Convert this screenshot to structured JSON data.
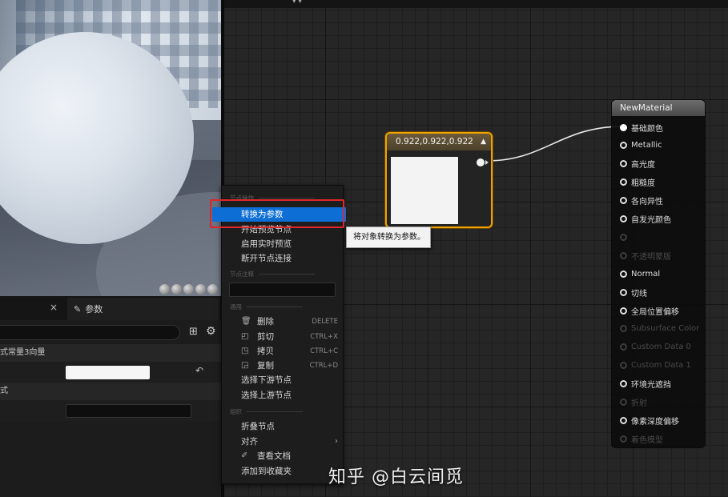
{
  "preview": {
    "view_mode_icons": [
      "sphere-icon",
      "sphere-icon",
      "cylinder-icon",
      "plane-icon",
      "teapot-icon"
    ]
  },
  "details": {
    "close_glyph": "×",
    "params_tab_label": "参数",
    "category1": "式常量3向量",
    "category2": "式",
    "reset_glyph": "↶"
  },
  "constant_node": {
    "title": "0.922,0.922,0.922",
    "color": "#ebebeb"
  },
  "material_node": {
    "title": "NewMaterial",
    "pins": [
      {
        "label": "基础颜色",
        "connected": true,
        "enabled": true
      },
      {
        "label": "Metallic",
        "connected": false,
        "enabled": true
      },
      {
        "label": "高光度",
        "connected": false,
        "enabled": true
      },
      {
        "label": "粗糙度",
        "connected": false,
        "enabled": true
      },
      {
        "label": "各向异性",
        "connected": false,
        "enabled": true
      },
      {
        "label": "自发光颜色",
        "connected": false,
        "enabled": true
      },
      {
        "label": "",
        "connected": false,
        "enabled": false
      },
      {
        "label": "不透明蒙版",
        "connected": false,
        "enabled": false
      },
      {
        "label": "Normal",
        "connected": false,
        "enabled": true
      },
      {
        "label": "切线",
        "connected": false,
        "enabled": true
      },
      {
        "label": "全局位置偏移",
        "connected": false,
        "enabled": true
      },
      {
        "label": "Subsurface Color",
        "connected": false,
        "enabled": false
      },
      {
        "label": "Custom Data 0",
        "connected": false,
        "enabled": false
      },
      {
        "label": "Custom Data 1",
        "connected": false,
        "enabled": false
      },
      {
        "label": "环境光遮挡",
        "connected": false,
        "enabled": true
      },
      {
        "label": "折射",
        "connected": false,
        "enabled": false
      },
      {
        "label": "像素深度偏移",
        "connected": false,
        "enabled": true
      },
      {
        "label": "着色模型",
        "connected": false,
        "enabled": false
      }
    ]
  },
  "context_menu": {
    "section_node_actions": "节点操作",
    "convert_to_param": "转换为参数",
    "start_preview_node": "开始预览节点",
    "enable_realtime_preview": "启用实时预览",
    "break_node_links": "断开节点连接",
    "section_node_comment": "节点注释",
    "section_general": "通用",
    "delete": "删除",
    "delete_shortcut": "DELETE",
    "cut": "剪切",
    "cut_shortcut": "CTRL+X",
    "copy": "拷贝",
    "copy_shortcut": "CTRL+C",
    "duplicate": "复制",
    "duplicate_shortcut": "CTRL+D",
    "select_downstream": "选择下游节点",
    "select_upstream": "选择上游节点",
    "section_organize": "组织",
    "collapse_node": "折叠节点",
    "align": "对齐",
    "view_docs": "查看文档",
    "add_to_favorites": "添加到收藏夹"
  },
  "tooltip": "将对象转换为参数。",
  "watermark": "知乎 @白云间觅",
  "colors": {
    "selection_blue": "#0d6fd6",
    "node_selected_orange": "#f0a200",
    "highlight_red": "#e0252b"
  }
}
